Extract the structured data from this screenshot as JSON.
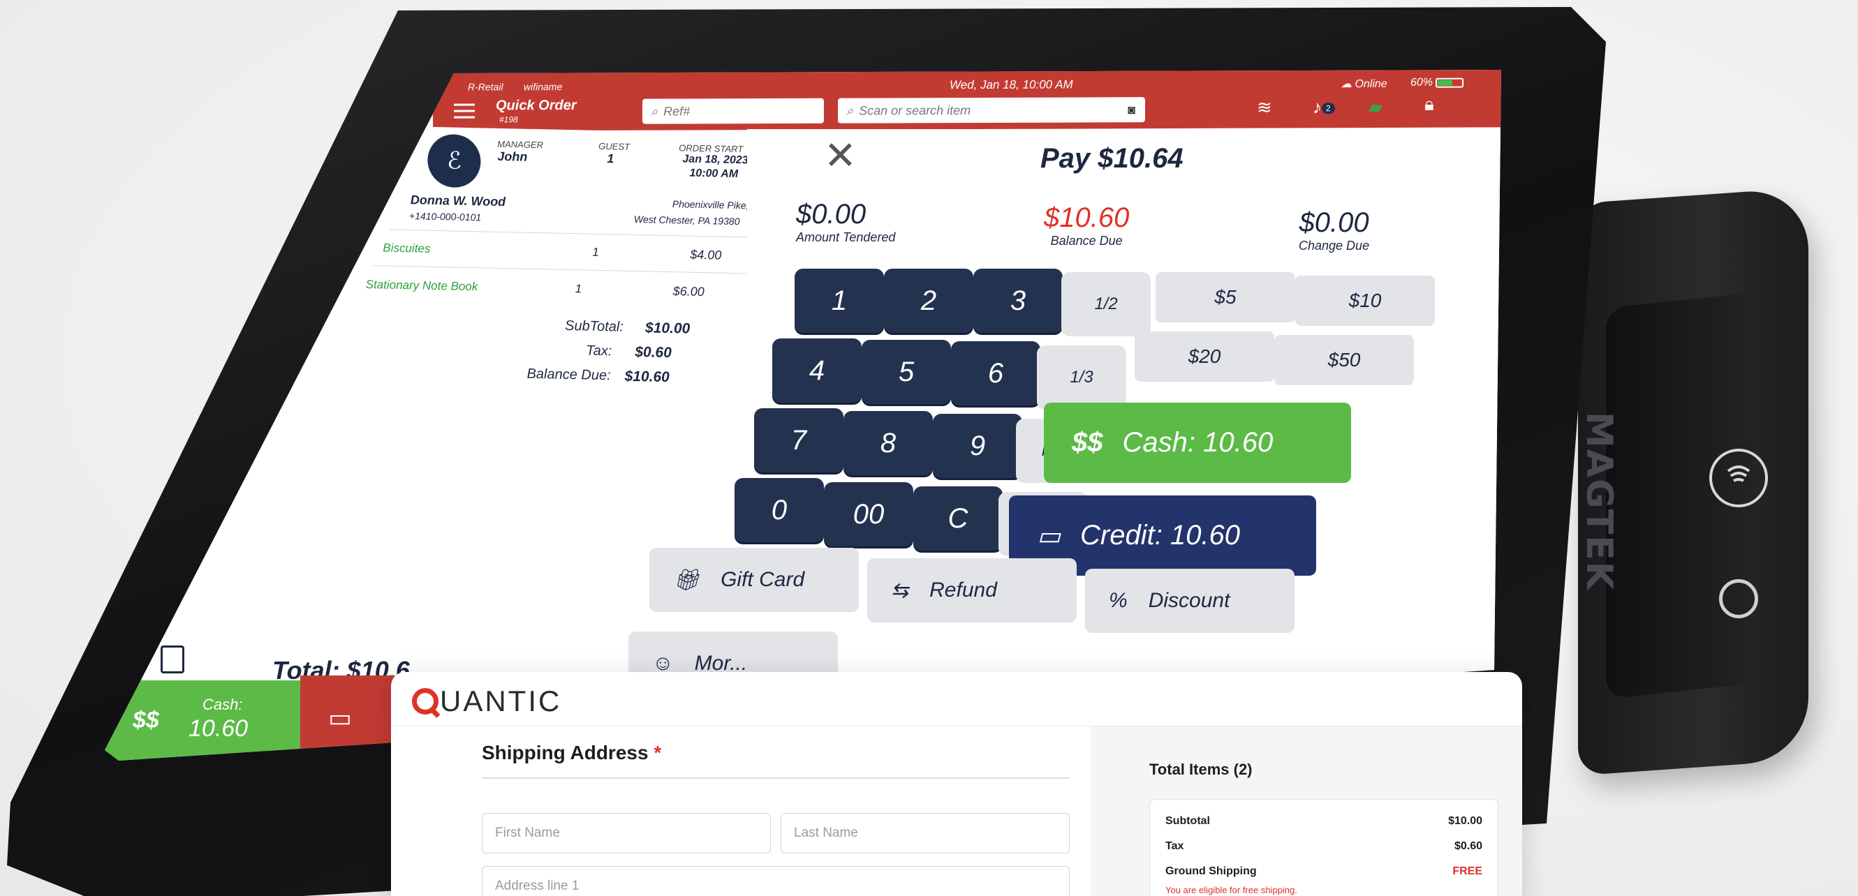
{
  "device": {
    "reader_brand": "MAGTEK"
  },
  "pos": {
    "topbar": {
      "store": "R-Retail",
      "network": "wifiname",
      "title": "Quick Order",
      "order_number": "#198",
      "ref_placeholder": "Ref#",
      "search_placeholder": "Scan or search item",
      "datetime": "Wed, Jan 18, 10:00 AM",
      "status": "Online",
      "battery": "60%",
      "battery_level": 0.6,
      "notification_count": "2"
    },
    "order": {
      "manager_label": "MANAGER",
      "manager": "John",
      "guest_label": "GUEST",
      "guest": "1",
      "start_label": "ORDER START",
      "start_date": "Jan 18, 2023",
      "start_time": "10:00 AM",
      "customer_name": "Donna W. Wood",
      "customer_phone": "+1410-000-0101",
      "address_line1": "Phoenixville Pike,",
      "address_line2": "West Chester, PA 19380",
      "items": [
        {
          "name": "Biscuites",
          "qty": "1",
          "price": "$4.00"
        },
        {
          "name": "Stationary Note Book",
          "qty": "1",
          "price": "$6.00"
        }
      ],
      "subtotal_label": "SubTotal:",
      "subtotal": "$10.00",
      "tax_label": "Tax:",
      "tax": "$0.60",
      "balance_label": "Balance Due:",
      "balance": "$10.60",
      "total_label": "Total:",
      "total": "$10.6",
      "cash_label": "Cash:",
      "cash_value": "10.60"
    },
    "pay": {
      "title": "Pay $10.64",
      "tendered": "$0.00",
      "tendered_label": "Amount Tendered",
      "balance": "$10.60",
      "balance_label": "Balance Due",
      "change": "$0.00",
      "change_label": "Change Due",
      "keys": [
        "1",
        "2",
        "3",
        "4",
        "5",
        "6",
        "7",
        "8",
        "9",
        "0",
        "00",
        "C"
      ],
      "fractions": [
        "1/2",
        "1/3",
        "More"
      ],
      "quick_amounts": [
        "$5",
        "$10",
        "$20",
        "$50"
      ],
      "cash_button": "Cash: 10.60",
      "credit_button": "Credit: 10.60",
      "gift_card": "Gift Card",
      "refund": "Refund",
      "discount": "Discount",
      "more_partial": "Mor..."
    }
  },
  "checkout": {
    "logo_text": "UANTIC",
    "shipping_title": "Shipping Address",
    "required_mark": "*",
    "first_name_placeholder": "First Name",
    "last_name_placeholder": "Last Name",
    "address_placeholder": "Address line 1",
    "summary_title": "Total Items (2)",
    "subtotal_label": "Subtotal",
    "subtotal": "$10.00",
    "tax_label": "Tax",
    "tax": "$0.60",
    "shipping_label": "Ground Shipping",
    "shipping": "FREE",
    "shipping_note": "You are eligible for free shipping."
  },
  "colors": {
    "brand_red": "#c23b33",
    "navy": "#23324f",
    "cash_green": "#5cba47",
    "credit_blue": "#23336b"
  }
}
